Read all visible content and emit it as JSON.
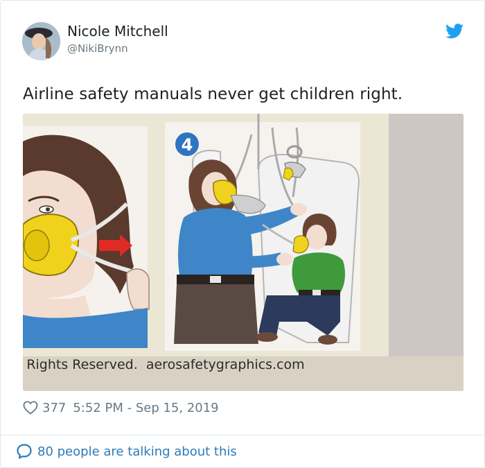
{
  "author": {
    "name": "Nicole Mitchell",
    "handle": "@NikiBrynn"
  },
  "tweet": {
    "text": "Airline safety manuals never get children right."
  },
  "media": {
    "step_number": "4",
    "footer_text": "l Rights Reserved.  aerosafetygraphics.com"
  },
  "meta": {
    "like_count": "377",
    "timestamp": "5:52 PM - Sep 15, 2019"
  },
  "conversation": {
    "label": "80 people are talking about this"
  },
  "colors": {
    "brand_blue": "#1da1f2",
    "link_blue": "#2b7bb9",
    "muted_gray": "#697882"
  },
  "icons": [
    "twitter-bird-icon",
    "heart-icon",
    "speech-bubble-icon"
  ]
}
